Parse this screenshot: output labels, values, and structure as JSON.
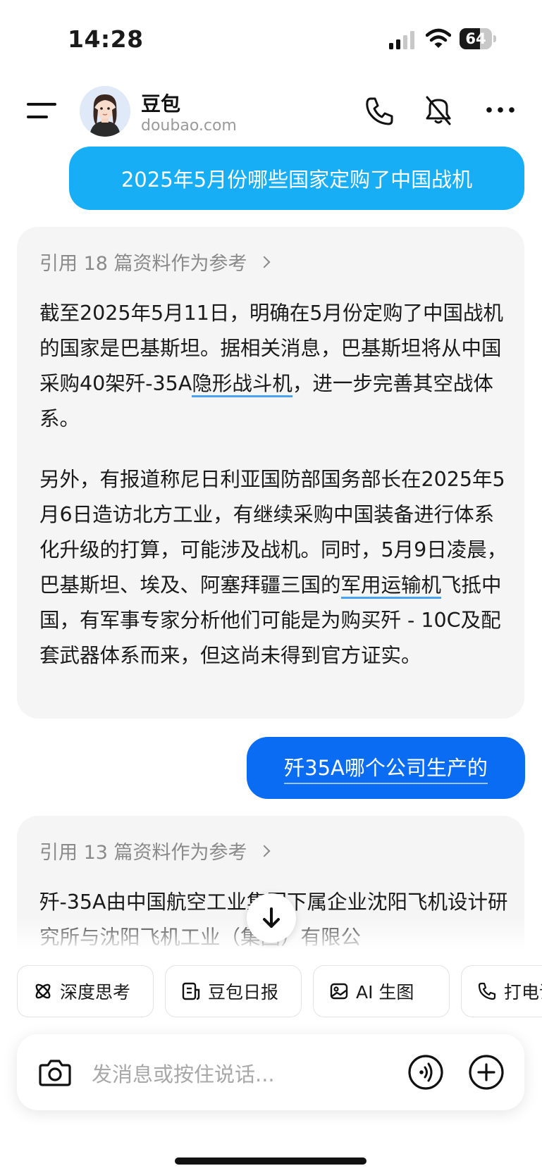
{
  "status_bar": {
    "time": "14:28",
    "battery_level": "64",
    "battery_fraction": 0.64
  },
  "header": {
    "bot_name": "豆包",
    "bot_domain": "doubao.com",
    "icons": [
      "menu-icon",
      "avatar",
      "phone-icon",
      "mute-icon",
      "more-icon"
    ]
  },
  "messages": {
    "user_1": "2025年5月份哪些国家定购了中国战机",
    "bot_1": {
      "reference": "引用 18 篇资料作为参考",
      "paragraph_1": {
        "text_a": "截至2025年5月11日，明确在5月份定购了中国战机的国家是巴基斯坦。据相关消息，巴基斯坦将从中国采购40架歼-35A",
        "link": "隐形战斗机",
        "text_b": "，进一步完善其空战体系。"
      },
      "paragraph_2": {
        "text_a": "另外，有报道称尼日利亚国防部国务部长在2025年5月6日造访北方工业，有继续采购中国装备进行体系化升级的打算，可能涉及战机。同时，5月9日凌晨，巴基斯坦、埃及、阿塞拜疆三国的",
        "link": "军用运输机",
        "text_b": "飞抵中国，有军事专家分析他们可能是为购买歼 - 10C及配套武器体系而来，但这尚未得到官方证实。"
      }
    },
    "user_2": "歼35A哪个公司生产的",
    "bot_2": {
      "reference": "引用 13 篇资料作为参考",
      "paragraph_1": "歼-35A由中国航空工业集团下属企业沈阳飞机设计研究所与沈阳飞机工业（集团）有限公"
    }
  },
  "chips": [
    {
      "label": "深度思考",
      "icon": "atom-icon"
    },
    {
      "label": "豆包日报",
      "icon": "news-icon"
    },
    {
      "label": "AI 生图",
      "icon": "image-icon"
    },
    {
      "label": "打电话",
      "icon": "phone-icon"
    }
  ],
  "input": {
    "placeholder": "发消息或按住说话..."
  },
  "colors": {
    "user_bubble_1": "#18aef6",
    "user_bubble_2": "#0a6cf2",
    "bot_card": "#f5f5f5",
    "link_underline": "#4aa3f2"
  }
}
